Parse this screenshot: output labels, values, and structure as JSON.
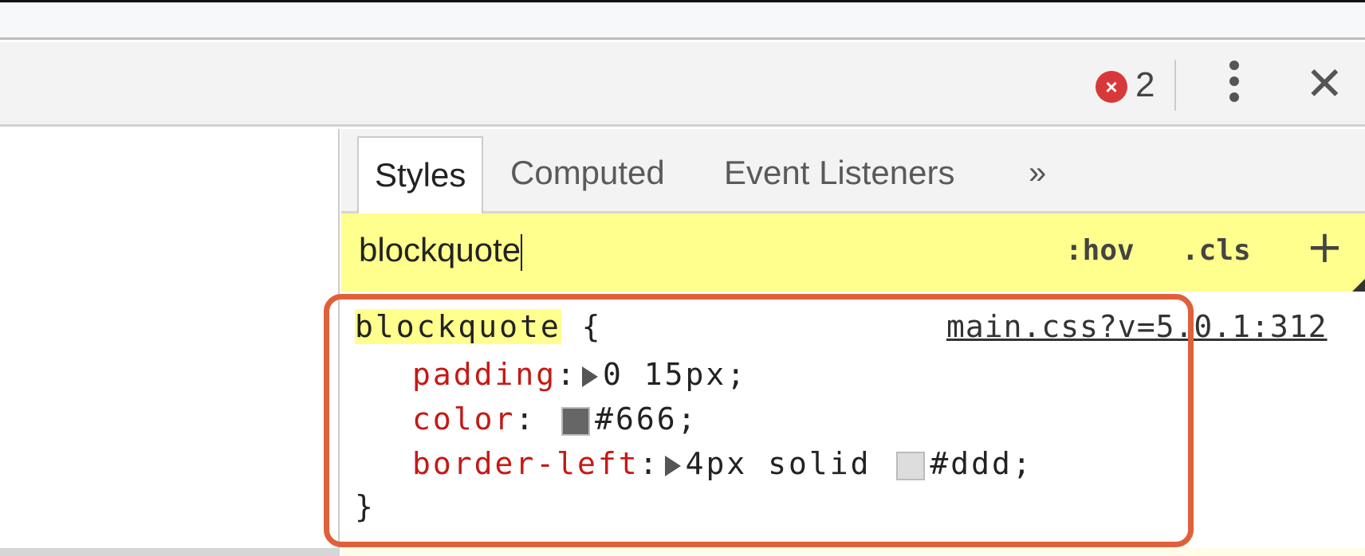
{
  "toolbar": {
    "error_count": "2",
    "error_icon": "error-circle-icon",
    "menu_icon": "kebab-menu-icon",
    "close_icon": "close-icon"
  },
  "tabs": [
    {
      "label": "Styles",
      "active": true
    },
    {
      "label": "Computed"
    },
    {
      "label": "Event Listeners"
    },
    {
      "label": "»"
    }
  ],
  "filter": {
    "value": "blockquote",
    "hov": ":hov",
    "cls": ".cls",
    "add": "+"
  },
  "rule": {
    "selector": "blockquote",
    "open": " {",
    "source": "main.css?v=5.0.1:312",
    "declarations": [
      {
        "property": "padding",
        "value": "0 15px;"
      },
      {
        "property": "color",
        "value": "#666;",
        "swatch": "#666666"
      },
      {
        "property": "border-left",
        "value_pre": "4px solid ",
        "value": "#ddd;",
        "swatch": "#dddddd"
      }
    ],
    "close": "}"
  },
  "highlight_color": "#e0603a"
}
